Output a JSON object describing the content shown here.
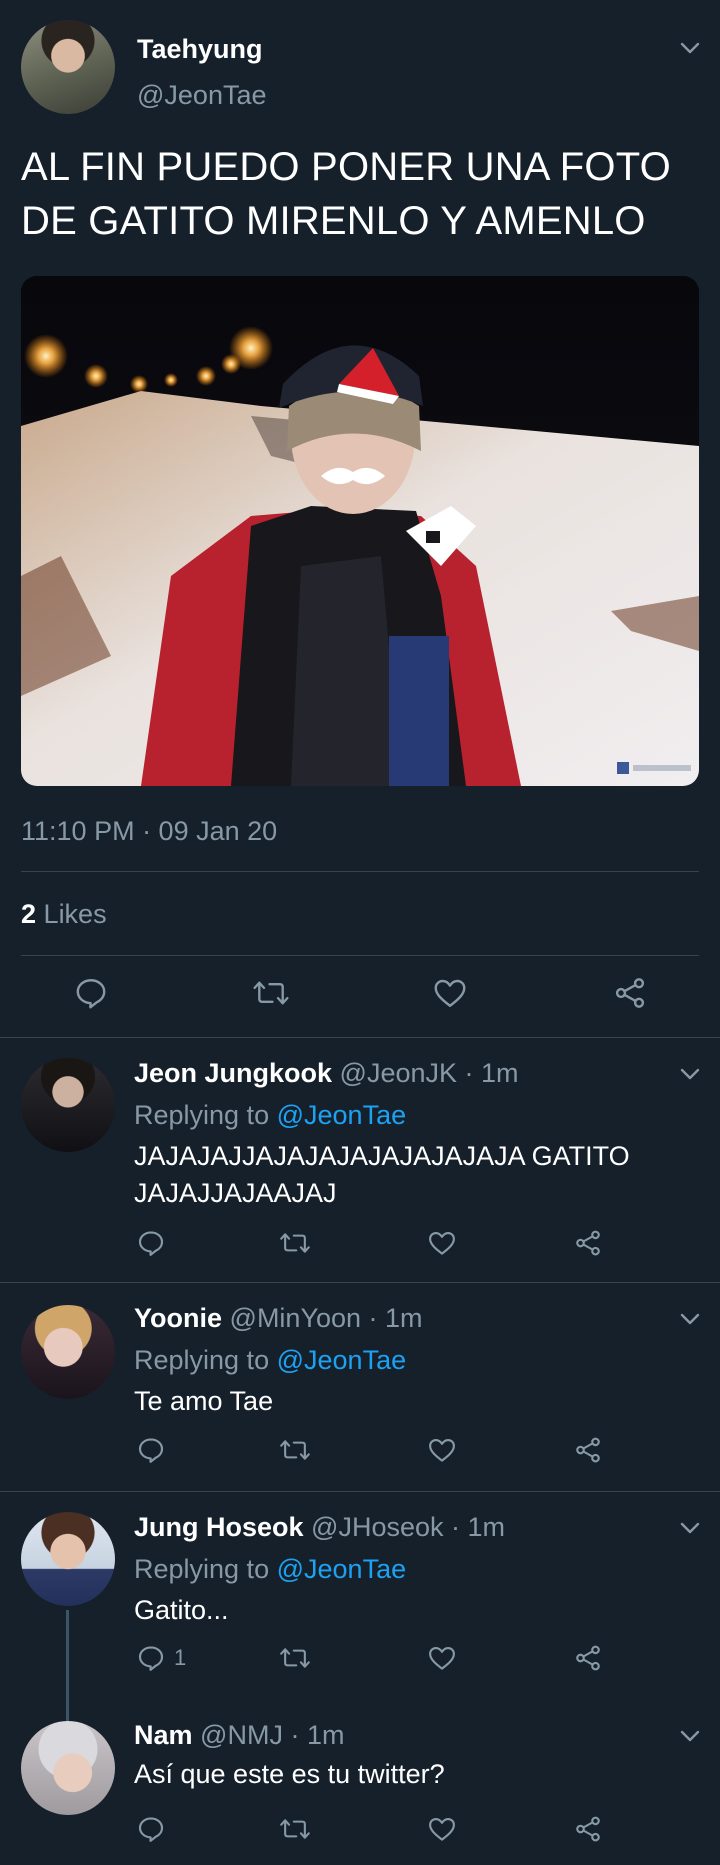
{
  "main_tweet": {
    "display_name": "Taehyung",
    "handle": "@JeonTae",
    "text": "AL FIN PUEDO PONER UNA FOTO DE GATITO MIRENLO Y AMENLO",
    "timestamp": "11:10 PM · 09 Jan 20",
    "likes_count": "2",
    "likes_label": "Likes",
    "photo_icon": "facebook-watermark-icon",
    "actions": [
      "reply-icon",
      "retweet-icon",
      "like-icon",
      "share-icon"
    ]
  },
  "replies": [
    {
      "display_name": "Jeon Jungkook",
      "meta": "@JeonJK · 1m",
      "replying_prefix": "Replying to",
      "replying_to": "@JeonTae",
      "text": "JAJAJAJJAJAJAJAJAJAJAJAJA GATITO JAJAJJAJAAJAJ",
      "reply_count": ""
    },
    {
      "display_name": "Yoonie",
      "meta": "@MinYoon · 1m",
      "replying_prefix": "Replying to",
      "replying_to": "@JeonTae",
      "text": "Te amo Tae",
      "reply_count": ""
    },
    {
      "display_name": "Jung Hoseok",
      "meta": "@JHoseok · 1m",
      "replying_prefix": "Replying to",
      "replying_to": "@JeonTae",
      "text": "Gatito...",
      "reply_count": "1"
    },
    {
      "display_name": "Nam",
      "meta": "@NMJ · 1m",
      "text": "Así que este es tu twitter?",
      "reply_count": ""
    }
  ],
  "colors": {
    "background": "#15202b",
    "secondary_text": "#8899a6",
    "link": "#1da1f2",
    "divider": "#38444d"
  }
}
